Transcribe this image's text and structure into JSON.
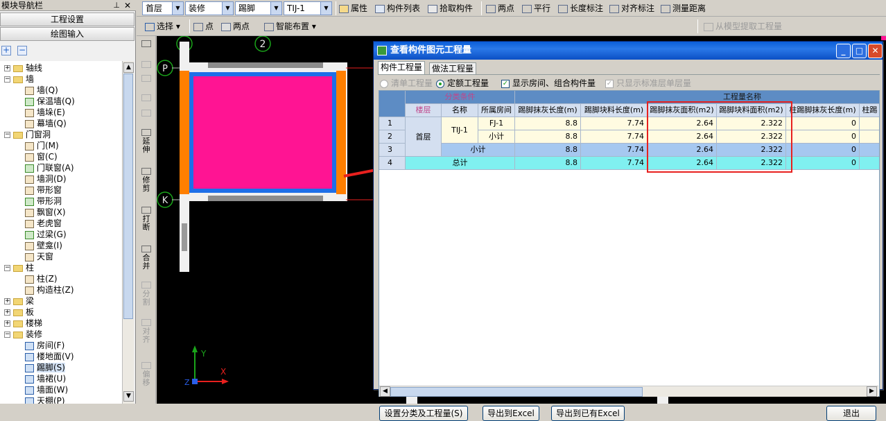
{
  "nav": {
    "title": "模块导航栏",
    "pin_icon": "pin-icon",
    "close_label": "✕",
    "btn_project_settings": "工程设置",
    "btn_drawing_input": "绘图输入",
    "plus": "+",
    "minus": "−",
    "tree": [
      {
        "level": 0,
        "expander": "+",
        "kind": "folder",
        "label": "轴线"
      },
      {
        "level": 0,
        "expander": "−",
        "kind": "folder",
        "label": "墙"
      },
      {
        "level": 1,
        "kind": "item",
        "label": "墙(Q)"
      },
      {
        "level": 1,
        "kind": "item",
        "label": "保温墙(Q)"
      },
      {
        "level": 1,
        "kind": "item",
        "label": "墙垛(E)"
      },
      {
        "level": 1,
        "kind": "item",
        "label": "幕墙(Q)"
      },
      {
        "level": 0,
        "expander": "−",
        "kind": "folder",
        "label": "门窗洞"
      },
      {
        "level": 1,
        "kind": "item",
        "label": "门(M)"
      },
      {
        "level": 1,
        "kind": "item",
        "label": "窗(C)"
      },
      {
        "level": 1,
        "kind": "item",
        "label": "门联窗(A)"
      },
      {
        "level": 1,
        "kind": "item",
        "label": "墙洞(D)"
      },
      {
        "level": 1,
        "kind": "item",
        "label": "带形窗"
      },
      {
        "level": 1,
        "kind": "item",
        "label": "带形洞"
      },
      {
        "level": 1,
        "kind": "item",
        "label": "飘窗(X)"
      },
      {
        "level": 1,
        "kind": "item",
        "label": "老虎窗"
      },
      {
        "level": 1,
        "kind": "item",
        "label": "过梁(G)"
      },
      {
        "level": 1,
        "kind": "item",
        "label": "壁龛(I)"
      },
      {
        "level": 1,
        "kind": "item",
        "label": "天窗"
      },
      {
        "level": 0,
        "expander": "−",
        "kind": "folder",
        "label": "柱"
      },
      {
        "level": 1,
        "kind": "item",
        "label": "柱(Z)"
      },
      {
        "level": 1,
        "kind": "item",
        "label": "构造柱(Z)"
      },
      {
        "level": 0,
        "expander": "+",
        "kind": "folder",
        "label": "梁"
      },
      {
        "level": 0,
        "expander": "+",
        "kind": "folder",
        "label": "板"
      },
      {
        "level": 0,
        "expander": "+",
        "kind": "folder",
        "label": "楼梯"
      },
      {
        "level": 0,
        "expander": "−",
        "kind": "folder",
        "label": "装修"
      },
      {
        "level": 1,
        "kind": "item",
        "label": "房间(F)"
      },
      {
        "level": 1,
        "kind": "item",
        "label": "楼地面(V)"
      },
      {
        "level": 1,
        "kind": "item",
        "label": "踢脚(S)",
        "selected": true
      },
      {
        "level": 1,
        "kind": "item",
        "label": "墙裙(U)"
      },
      {
        "level": 1,
        "kind": "item",
        "label": "墙面(W)"
      },
      {
        "level": 1,
        "kind": "item",
        "label": "天棚(P)"
      }
    ]
  },
  "toolbar1": {
    "floor": "首层",
    "category": "装修",
    "element_type": "踢脚",
    "element_name": "TIJ-1",
    "properties": "属性",
    "component_list": "构件列表",
    "pick_component": "拾取构件",
    "two_points": "两点",
    "parallel": "平行",
    "length_dim": "长度标注",
    "aligned_dim": "对齐标注",
    "measure_distance": "测量距离"
  },
  "toolbar2": {
    "select": "选择",
    "point": "点",
    "two_points": "两点",
    "smart_layout": "智能布置",
    "extract_qty": "从模型提取工程量"
  },
  "vtools": [
    {
      "label": "",
      "disabled": false
    },
    {
      "label": "",
      "disabled": true
    },
    {
      "label": "",
      "disabled": true
    },
    {
      "label": "",
      "disabled": true
    },
    {
      "label": "",
      "disabled": true
    },
    {
      "label": "延伸",
      "disabled": false
    },
    {
      "label": "修剪",
      "disabled": false
    },
    {
      "label": "打断",
      "disabled": false
    },
    {
      "label": "合并",
      "disabled": false
    },
    {
      "label": "分割",
      "disabled": true
    },
    {
      "label": "对齐",
      "disabled": true
    },
    {
      "label": "偏移",
      "disabled": true
    }
  ],
  "canvas": {
    "axis_markers": [
      "2",
      "P",
      "K"
    ],
    "axis_y": "Y",
    "axis_x": "X",
    "axis_z": "Z"
  },
  "dialog": {
    "title": "查看构件图元工程量",
    "minimize": "_",
    "maximize": "□",
    "close": "✕",
    "tabs": [
      "构件工程量",
      "做法工程量"
    ],
    "active_tab": 0,
    "options": {
      "list_qty": "清单工程量",
      "quota_qty": "定额工程量",
      "show_rooms": "显示房间、组合构件量",
      "std_floor_only": "只显示标准层单层量"
    },
    "table": {
      "group_left": "分类条件",
      "group_right": "工程量名称",
      "columns": [
        "楼层",
        "名称",
        "所属房间",
        "踢脚抹灰长度(m)",
        "踢脚块料长度(m)",
        "踢脚抹灰面积(m2)",
        "踢脚块料面积(m2)",
        "柱踢脚抹灰长度(m)",
        "柱踢"
      ],
      "rows": [
        {
          "no": "1",
          "floor": "首层",
          "name": "TIJ-1",
          "room": "FJ-1",
          "v1": "8.8",
          "v2": "7.74",
          "v3": "2.64",
          "v4": "2.322",
          "v5": "0"
        },
        {
          "no": "2",
          "floor": "",
          "name": "",
          "room": "小计",
          "v1": "8.8",
          "v2": "7.74",
          "v3": "2.64",
          "v4": "2.322",
          "v5": "0"
        },
        {
          "no": "3",
          "floor": "",
          "name": "小计",
          "room": "",
          "v1": "8.8",
          "v2": "7.74",
          "v3": "2.64",
          "v4": "2.322",
          "v5": "0"
        },
        {
          "no": "4",
          "floor": "总计",
          "name": "",
          "room": "",
          "v1": "8.8",
          "v2": "7.74",
          "v3": "2.64",
          "v4": "2.322",
          "v5": "0"
        }
      ]
    },
    "buttons": {
      "settings": "设置分类及工程量(S)",
      "export_excel": "导出到Excel",
      "export_existing": "导出到已有Excel",
      "exit": "退出"
    }
  },
  "colors": {
    "room_fill": "#ff1493",
    "baseboard": "#ff7f00",
    "wall": "#1e6fe8",
    "annotation": "#e8201e"
  }
}
